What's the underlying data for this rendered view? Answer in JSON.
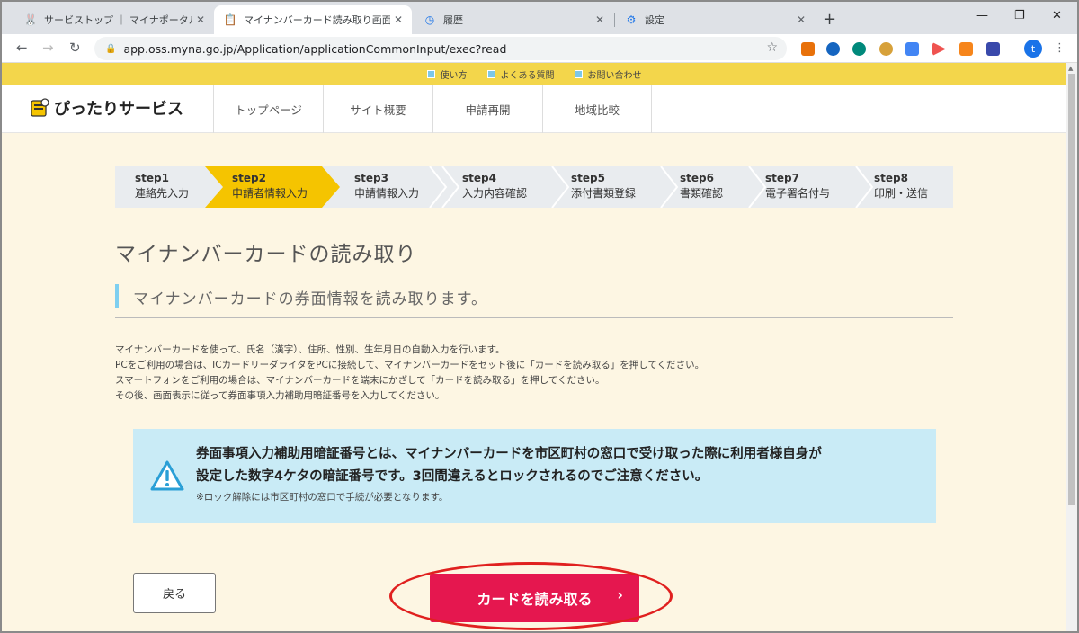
{
  "browser": {
    "tabs": [
      {
        "title": "サービストップ ｜ マイナポータル",
        "icon": "bunny-icon"
      },
      {
        "title": "マイナンバーカード読み取り画面（券",
        "icon": "pittari-icon"
      },
      {
        "title": "履歴",
        "icon": "history-icon"
      },
      {
        "title": "設定",
        "icon": "gear-icon"
      }
    ],
    "url": "app.oss.myna.go.jp/Application/applicationCommonInput/exec?read",
    "avatar_letter": "t"
  },
  "top_links": [
    "使い方",
    "よくある質問",
    "お問い合わせ"
  ],
  "header": {
    "logo": "ぴったりサービス",
    "nav": [
      "トップページ",
      "サイト概要",
      "申請再開",
      "地域比較"
    ]
  },
  "steps": [
    {
      "num": "step1",
      "label": "連絡先入力"
    },
    {
      "num": "step2",
      "label": "申請者情報入力"
    },
    {
      "num": "step3",
      "label": "申請情報入力"
    },
    {
      "num": "step4",
      "label": "入力内容確認"
    },
    {
      "num": "step5",
      "label": "添付書類登録"
    },
    {
      "num": "step6",
      "label": "書類確認"
    },
    {
      "num": "step7",
      "label": "電子署名付与"
    },
    {
      "num": "step8",
      "label": "印刷・送信"
    }
  ],
  "active_step": 1,
  "main": {
    "title": "マイナンバーカードの読み取り",
    "subtitle": "マイナンバーカードの券面情報を読み取ります。",
    "description": [
      "マイナンバーカードを使って、氏名（漢字）、住所、性別、生年月日の自動入力を行います。",
      "PCをご利用の場合は、ICカードリーダライタをPCに接続して、マイナンバーカードをセット後に「カードを読み取る」を押してください。",
      "スマートフォンをご利用の場合は、マイナンバーカードを端末にかざして「カードを読み取る」を押してください。",
      "その後、画面表示に従って券面事項入力補助用暗証番号を入力してください。"
    ],
    "notice": {
      "line1": "券面事項入力補助用暗証番号とは、マイナンバーカードを市区町村の窓口で受け取った際に利用者様自身が",
      "line2": "設定した数字4ケタの暗証番号です。3回間違えるとロックされるのでご注意ください。",
      "sub": "※ロック解除には市区町村の窓口で手続が必要となります。"
    },
    "back_button": "戻る",
    "read_button": "カードを読み取る"
  },
  "colors": {
    "accent": "#e5174f",
    "step_active": "#f5c400",
    "top_strip": "#f3d64b",
    "notice_bg": "#c9ebf6",
    "annotation": "#e0201f"
  }
}
